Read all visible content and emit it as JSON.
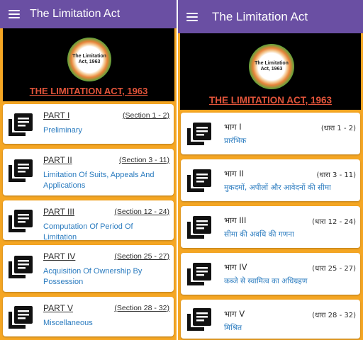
{
  "colors": {
    "appbar": "#6a4fa3",
    "background": "#f5a623",
    "link": "#2a7bbf",
    "banner_title": "#e2543a"
  },
  "screens": [
    {
      "appbar": {
        "menu_icon": "hamburger-menu-icon",
        "title": "The Limitation Act"
      },
      "banner": {
        "emblem_line1": "The Limitation",
        "emblem_line2": "Act, 1963",
        "title": "THE LIMITATION ACT, 1963"
      },
      "parts": [
        {
          "label": "PART I",
          "sections": "(Section 1 - 2)",
          "title": "Preliminary",
          "icon": "book-stack-icon"
        },
        {
          "label": "PART II",
          "sections": "(Section 3 - 11)",
          "title": "Limitation Of Suits, Appeals And Applications",
          "icon": "book-stack-icon"
        },
        {
          "label": "PART III",
          "sections": "(Section 12 - 24)",
          "title": "Computation Of Period Of Limitation",
          "icon": "book-stack-icon"
        },
        {
          "label": "PART IV",
          "sections": "(Section 25 - 27)",
          "title": "Acquisition Of Ownership By Possession",
          "icon": "book-stack-icon"
        },
        {
          "label": "PART V",
          "sections": "(Section 28 - 32)",
          "title": "Miscellaneous",
          "icon": "book-stack-icon"
        }
      ]
    },
    {
      "appbar": {
        "menu_icon": "hamburger-menu-icon",
        "title": "The Limitation Act"
      },
      "banner": {
        "emblem_line1": "The Limitation",
        "emblem_line2": "Act, 1963",
        "title": "THE LIMITATION ACT, 1963"
      },
      "parts": [
        {
          "label": "भाग I",
          "sections": "(धारा 1 - 2)",
          "title": "प्रारंभिक",
          "icon": "book-stack-icon"
        },
        {
          "label": "भाग II",
          "sections": "(धारा 3 - 11)",
          "title": "मुकदमों, अपीलों और आवेदनों की सीमा",
          "icon": "book-stack-icon"
        },
        {
          "label": "भाग III",
          "sections": "(धारा 12 - 24)",
          "title": "सीमा की अवधि की गणना",
          "icon": "book-stack-icon"
        },
        {
          "label": "भाग IV",
          "sections": "(धारा 25 - 27)",
          "title": "कब्जे से स्वामित्व का अधिग्रहण",
          "icon": "book-stack-icon"
        },
        {
          "label": "भाग V",
          "sections": "(धारा 28 - 32)",
          "title": "मिश्रित",
          "icon": "book-stack-icon"
        }
      ]
    }
  ]
}
